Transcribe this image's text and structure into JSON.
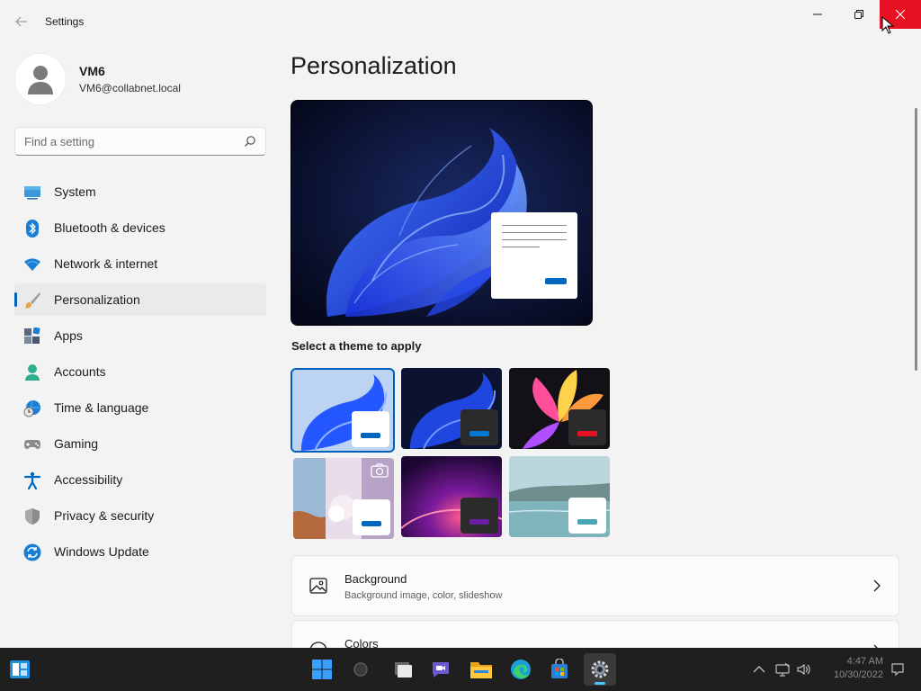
{
  "window": {
    "title": "Settings",
    "close_color": "#e81123",
    "accent": "#005fb8"
  },
  "profile": {
    "name": "VM6",
    "email": "VM6@collabnet.local"
  },
  "search": {
    "placeholder": "Find a setting"
  },
  "sidebar": {
    "items": [
      {
        "label": "System",
        "icon": "monitor-icon"
      },
      {
        "label": "Bluetooth & devices",
        "icon": "bluetooth-icon"
      },
      {
        "label": "Network & internet",
        "icon": "wifi-icon"
      },
      {
        "label": "Personalization",
        "icon": "brush-icon",
        "active": true
      },
      {
        "label": "Apps",
        "icon": "apps-icon"
      },
      {
        "label": "Accounts",
        "icon": "person-icon"
      },
      {
        "label": "Time & language",
        "icon": "globe-clock-icon"
      },
      {
        "label": "Gaming",
        "icon": "gamepad-icon"
      },
      {
        "label": "Accessibility",
        "icon": "accessibility-icon"
      },
      {
        "label": "Privacy & security",
        "icon": "shield-icon"
      },
      {
        "label": "Windows Update",
        "icon": "sync-icon"
      }
    ]
  },
  "main": {
    "title": "Personalization",
    "themes_label": "Select a theme to apply",
    "themes": [
      {
        "name": "windows-light",
        "selected": true,
        "bar_color": "#0067c0"
      },
      {
        "name": "windows-dark",
        "selected": false,
        "bar_color": "#0078d4"
      },
      {
        "name": "glow",
        "selected": false,
        "bar_color": "#e81123"
      },
      {
        "name": "captured-motion",
        "selected": false,
        "bar_color": "#0067c0"
      },
      {
        "name": "sunrise",
        "selected": false,
        "bar_color": "#6b1fa1"
      },
      {
        "name": "flow",
        "selected": false,
        "bar_color": "#48a6b7"
      }
    ],
    "cards": [
      {
        "title": "Background",
        "subtitle": "Background image, color, slideshow",
        "icon": "image-icon"
      },
      {
        "title": "Colors",
        "subtitle": "",
        "icon": "palette-icon"
      }
    ]
  },
  "taskbar": {
    "apps": [
      "widgets-icon",
      "start-icon",
      "search-icon",
      "task-view-icon",
      "teams-chat-icon",
      "file-explorer-icon",
      "edge-icon",
      "store-icon",
      "settings-icon"
    ],
    "active_app": "settings-icon",
    "tray": [
      "chevron-up-icon",
      "network-icon",
      "volume-icon"
    ],
    "time": "4:47 AM",
    "date": "10/30/2022"
  }
}
